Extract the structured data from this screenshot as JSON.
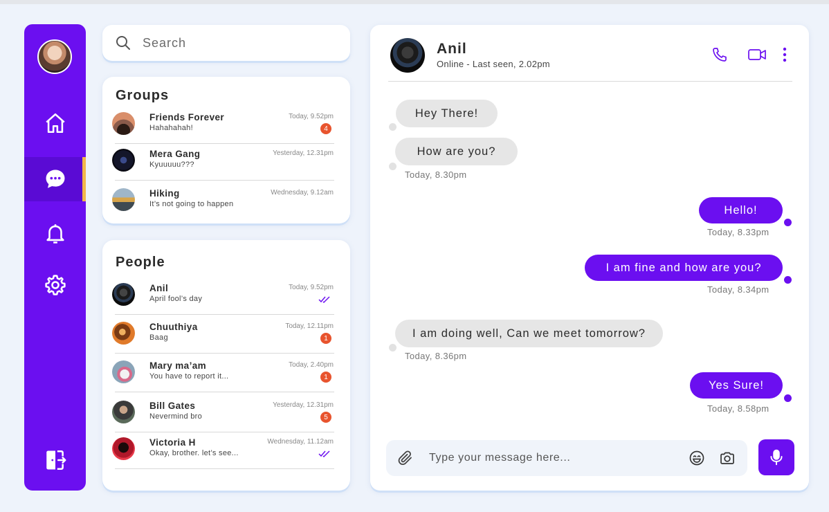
{
  "search": {
    "placeholder": "Search"
  },
  "groups": {
    "title": "Groups",
    "items": [
      {
        "name": "Friends Forever",
        "message": "Hahahahah!",
        "time": "Today, 9.52pm",
        "badge": "4"
      },
      {
        "name": "Mera Gang",
        "message": "Kyuuuuu???",
        "time": "Yesterday, 12.31pm"
      },
      {
        "name": "Hiking",
        "message": "It’s not going to happen",
        "time": "Wednesday, 9.12am"
      }
    ]
  },
  "people": {
    "title": "People",
    "items": [
      {
        "name": "Anil",
        "message": "April fool’s day",
        "time": "Today, 9.52pm",
        "read": true
      },
      {
        "name": "Chuuthiya",
        "message": "Baag",
        "time": "Today, 12.11pm",
        "badge": "1"
      },
      {
        "name": "Mary ma’am",
        "message": "You have to report it...",
        "time": "Today, 2.40pm",
        "badge": "1"
      },
      {
        "name": "Bill Gates",
        "message": "Nevermind bro",
        "time": "Yesterday, 12.31pm",
        "badge": "5"
      },
      {
        "name": "Victoria H",
        "message": "Okay, brother. let’s see...",
        "time": "Wednesday, 11.12am",
        "read": true
      }
    ]
  },
  "chat": {
    "contact_name": "Anil",
    "status": "Online - Last seen, 2.02pm",
    "messages": [
      {
        "direction": "in",
        "text": "Hey There!"
      },
      {
        "direction": "in",
        "text": "How are you?",
        "time": "Today, 8.30pm"
      },
      {
        "direction": "out",
        "text": "Hello!",
        "time": "Today, 8.33pm"
      },
      {
        "direction": "out",
        "text": "I am fine and how are you?",
        "time": "Today, 8.34pm"
      },
      {
        "direction": "in",
        "text": "I am doing well, Can we meet tomorrow?",
        "time": "Today, 8.36pm"
      },
      {
        "direction": "out",
        "text": "Yes Sure!",
        "time": "Today, 8.58pm"
      }
    ],
    "input_placeholder": "Type your message here..."
  },
  "sidebar": {
    "icons": [
      "home-icon",
      "chat-icon",
      "bell-icon",
      "settings-icon",
      "logout-icon"
    ],
    "active": "chat-icon"
  },
  "colors": {
    "accent": "#6b0ff0",
    "active_marker": "#f3b64b",
    "badge": "#e8542e",
    "incoming_bubble": "#e6e6e6",
    "background": "#eef3fb"
  }
}
